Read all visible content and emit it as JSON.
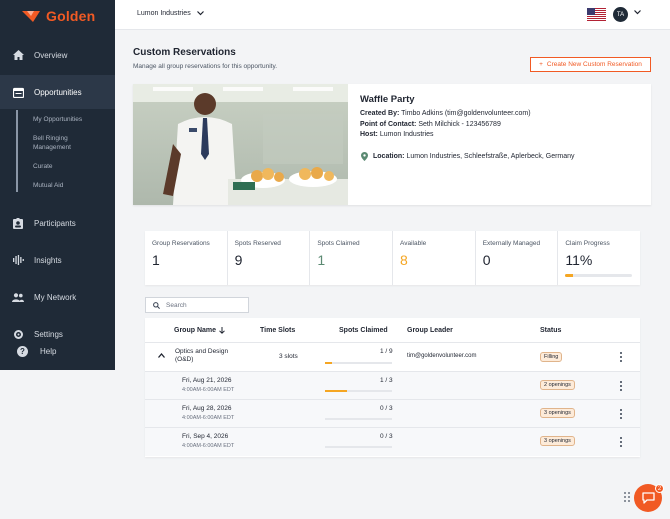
{
  "app": {
    "brand": "Golden",
    "brand_color": "#f15a24",
    "sidebar_color": "#1f2a37"
  },
  "sidebar": {
    "items": [
      {
        "label": "Overview",
        "icon": "home-icon"
      },
      {
        "label": "Opportunities",
        "icon": "calendar-icon",
        "active": true
      },
      {
        "label": "Participants",
        "icon": "id-badge-icon"
      },
      {
        "label": "Insights",
        "icon": "waveform-icon"
      },
      {
        "label": "My Network",
        "icon": "people-icon"
      },
      {
        "label": "Settings",
        "icon": "gear-icon"
      }
    ],
    "subitems": [
      "My Opportunities",
      "Bell Ringing",
      "Management",
      "Curate",
      "Mutual Aid"
    ],
    "help": "Help"
  },
  "topbar": {
    "org": "Lumon Industries",
    "avatar_initials": "TA"
  },
  "page": {
    "title": "Custom Reservations",
    "subtitle": "Manage all group reservations for this opportunity.",
    "create_button": "Create New Custom Reservation"
  },
  "event": {
    "title": "Waffle Party",
    "created_by_label": "Created By:",
    "created_by": "Timbo Adkins (tim@goldenvolunteer.com)",
    "contact_label": "Point of Contact:",
    "contact": "Seth Milchick - 123456789",
    "host_label": "Host:",
    "host": "Lumon Industries",
    "location_label": "Location:",
    "location": "Lumon Industries, Schleefstraße, Aplerbeck, Germany"
  },
  "stats": [
    {
      "label": "Group Reservations",
      "value": "1",
      "color": "#1f2430"
    },
    {
      "label": "Spots Reserved",
      "value": "9",
      "color": "#1f2430"
    },
    {
      "label": "Spots Claimed",
      "value": "1",
      "color": "#5b8a72"
    },
    {
      "label": "Available",
      "value": "8",
      "color": "#f5a623"
    },
    {
      "label": "Externally Managed",
      "value": "0",
      "color": "#1f2430"
    },
    {
      "label": "Claim Progress",
      "value": "11%",
      "color": "#1f2430",
      "progress": 0.11
    }
  ],
  "search": {
    "placeholder": "Search"
  },
  "table": {
    "headers": {
      "group_name": "Group Name",
      "time_slots": "Time Slots",
      "spots_claimed": "Spots Claimed",
      "group_leader": "Group Leader",
      "status": "Status"
    },
    "group": {
      "name_line1": "Optics and Design",
      "name_line2": "(O&D)",
      "slots": "3 slots",
      "claimed": "1 / 9",
      "progress": 0.11,
      "leader": "tim@goldenvolunteer.com",
      "status": "Filling"
    },
    "children": [
      {
        "date": "Fri, Aug 21, 2026",
        "time": "4:00AM-6:00AM EDT",
        "claimed": "1 / 3",
        "progress": 0.33,
        "status": "2 openings"
      },
      {
        "date": "Fri, Aug 28, 2026",
        "time": "4:00AM-6:00AM EDT",
        "claimed": "0 / 3",
        "progress": 0.0,
        "status": "3 openings"
      },
      {
        "date": "Fri, Sep 4, 2026",
        "time": "4:00AM-6:00AM EDT",
        "claimed": "0 / 3",
        "progress": 0.0,
        "status": "3 openings"
      }
    ]
  },
  "chat": {
    "badge": "2"
  }
}
